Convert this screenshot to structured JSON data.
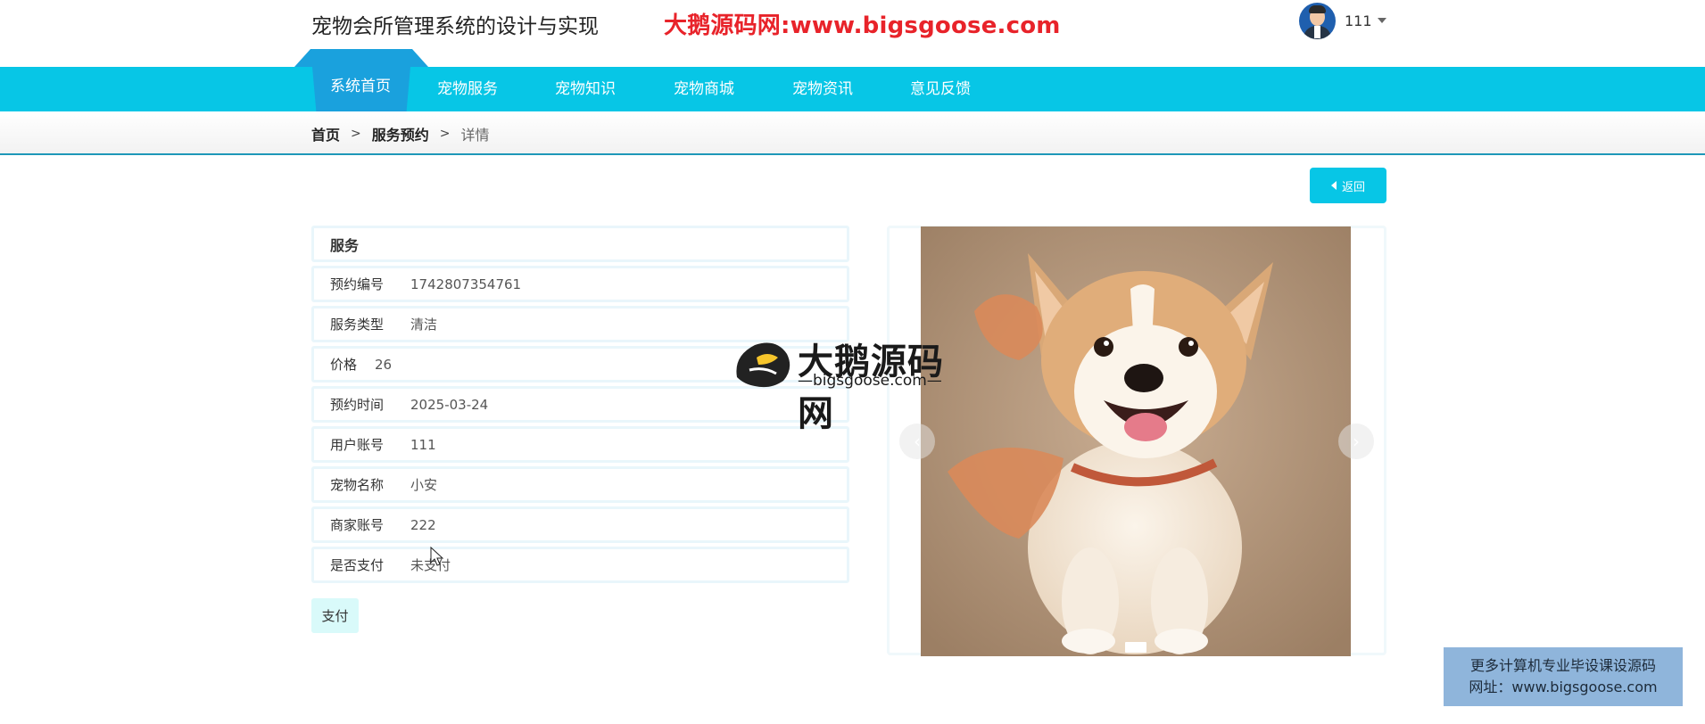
{
  "header": {
    "site_title": "宠物会所管理系统的设计与实现",
    "watermark_text": "大鹅源码网:www.bigsgoose.com",
    "username": "111"
  },
  "nav": {
    "items": [
      {
        "label": "系统首页",
        "active": true
      },
      {
        "label": "宠物服务",
        "active": false
      },
      {
        "label": "宠物知识",
        "active": false
      },
      {
        "label": "宠物商城",
        "active": false
      },
      {
        "label": "宠物资讯",
        "active": false
      },
      {
        "label": "意见反馈",
        "active": false
      }
    ]
  },
  "breadcrumb": {
    "home": "首页",
    "section": "服务预约",
    "current": "详情",
    "separator": ">"
  },
  "back_button": {
    "label": "返回"
  },
  "detail": {
    "title": "服务",
    "fields": [
      {
        "label": "预约编号",
        "value": "1742807354761"
      },
      {
        "label": "服务类型",
        "value": "清洁"
      },
      {
        "label": "价格",
        "value": "26"
      },
      {
        "label": "预约时间",
        "value": "2025-03-24"
      },
      {
        "label": "用户账号",
        "value": "111"
      },
      {
        "label": "宠物名称",
        "value": "小安"
      },
      {
        "label": "商家账号",
        "value": "222"
      },
      {
        "label": "是否支付",
        "value": "未支付"
      }
    ]
  },
  "pay_button": {
    "label": "支付"
  },
  "carousel": {
    "prev_icon": "chevron-left-icon",
    "next_icon": "chevron-right-icon",
    "prev_glyph": "‹",
    "next_glyph": "›"
  },
  "overlay_logo": {
    "title": "大鹅源码网",
    "subtitle": "—bigsgoose.com—"
  },
  "notice": {
    "line1": "更多计算机专业毕设课设源码",
    "line2": "网址：www.bigsgoose.com"
  },
  "colors": {
    "accent": "#07c6e6",
    "nav_active": "#1aa1dd",
    "watermark_red": "#e8232a",
    "notice_bg": "#8fb5db"
  }
}
